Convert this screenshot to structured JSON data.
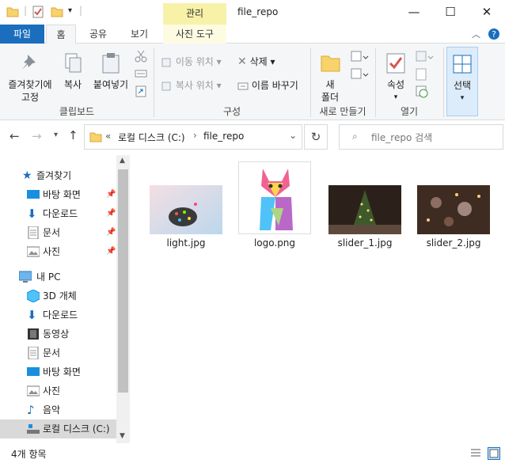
{
  "window": {
    "title": "file_repo",
    "contextual_tab_head": "관리",
    "minimize_glyph": "—",
    "maximize_glyph": "☐",
    "close_glyph": "✕"
  },
  "ribbon_tabs": {
    "file": "파일",
    "home": "홈",
    "share": "공유",
    "view": "보기",
    "picture_tools": "사진 도구"
  },
  "ribbon": {
    "clipboard": {
      "pin_label": "즐겨찾기에\n고정",
      "copy_label": "복사",
      "paste_label": "붙여넣기",
      "group_label": "클립보드"
    },
    "organize": {
      "move_to": "이동 위치",
      "copy_to": "복사 위치",
      "delete": "삭제",
      "rename": "이름 바꾸기",
      "group_label": "구성"
    },
    "new": {
      "new_folder": "새\n폴더",
      "group_label": "새로 만들기"
    },
    "open": {
      "properties": "속성",
      "group_label": "열기"
    },
    "select": {
      "select_label": "선택"
    }
  },
  "address": {
    "overflow": "«",
    "crumbs": [
      "로컬 디스크 (C:)",
      "file_repo"
    ],
    "search_placeholder": "file_repo 검색"
  },
  "nav_pane": {
    "quick_access": "즐겨찾기",
    "quick_items": [
      "바탕 화면",
      "다운로드",
      "문서",
      "사진"
    ],
    "this_pc": "내 PC",
    "pc_items": [
      "3D 개체",
      "다운로드",
      "동영상",
      "문서",
      "바탕 화면",
      "사진",
      "음악",
      "로컬 디스크 (C:)"
    ]
  },
  "files": [
    {
      "name": "light.jpg"
    },
    {
      "name": "logo.png"
    },
    {
      "name": "slider_1.jpg"
    },
    {
      "name": "slider_2.jpg"
    }
  ],
  "status": {
    "item_count": "4개 항목"
  },
  "colors": {
    "file_tab": "#1a6ebd",
    "contextual_tab": "#f7f2a8",
    "selected_nav": "#cce8ff",
    "folder": "#f8d26a"
  }
}
